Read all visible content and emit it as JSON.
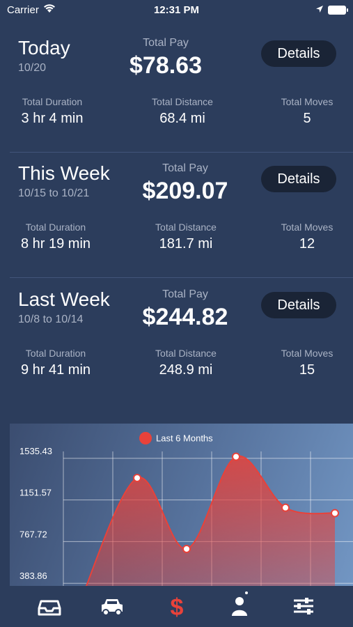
{
  "status": {
    "carrier": "Carrier",
    "time": "12:31 PM"
  },
  "sections": [
    {
      "title": "Today",
      "range": "10/20",
      "pay_label": "Total Pay",
      "pay": "$78.63",
      "details": "Details",
      "duration_label": "Total Duration",
      "duration": "3 hr 4 min",
      "distance_label": "Total Distance",
      "distance": "68.4 mi",
      "moves_label": "Total Moves",
      "moves": "5"
    },
    {
      "title": "This Week",
      "range": "10/15 to 10/21",
      "pay_label": "Total Pay",
      "pay": "$209.07",
      "details": "Details",
      "duration_label": "Total Duration",
      "duration": "8 hr 19 min",
      "distance_label": "Total Distance",
      "distance": "181.7 mi",
      "moves_label": "Total Moves",
      "moves": "12"
    },
    {
      "title": "Last Week",
      "range": "10/8 to 10/14",
      "pay_label": "Total Pay",
      "pay": "$244.82",
      "details": "Details",
      "duration_label": "Total Duration",
      "duration": "9 hr 41 min",
      "distance_label": "Total Distance",
      "distance": "248.9 mi",
      "moves_label": "Total Moves",
      "moves": "15"
    }
  ],
  "chart_data": {
    "type": "area",
    "legend": "Last 6 Months",
    "series_color": "#e8423a",
    "y_ticks": [
      "383.86",
      "767.72",
      "1151.57",
      "1535.43"
    ],
    "y_tick_values": [
      383.86,
      767.72,
      1151.57,
      1535.43
    ],
    "values": [
      0,
      1354,
      700,
      1550,
      1080,
      1030
    ],
    "ylim": [
      0,
      1650
    ],
    "grid": true
  },
  "tabs": [
    {
      "icon": "inbox-tray-icon",
      "active": false
    },
    {
      "icon": "car-icon",
      "active": false
    },
    {
      "icon": "dollar-icon",
      "active": true
    },
    {
      "icon": "person-icon",
      "active": false
    },
    {
      "icon": "sliders-icon",
      "active": false
    }
  ],
  "colors": {
    "background": "#2c3d5c",
    "button": "#1a2436",
    "accent": "#e8423a",
    "muted": "#aab3c5"
  }
}
